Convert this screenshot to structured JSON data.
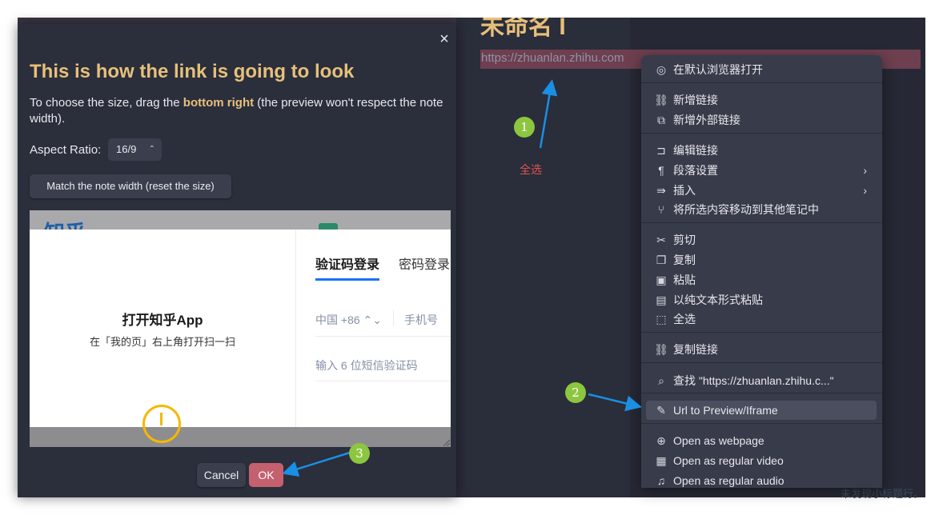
{
  "editor": {
    "note_title": "未命名 I",
    "link_text": "https://zhuanlan.zhihu.com",
    "status_text": "未发现小标题行。"
  },
  "annotations": {
    "step1": "1",
    "step2": "2",
    "step3": "3",
    "label1": "全选",
    "color_circle": "#8cc63f",
    "color_arrow": "#1a8fe3",
    "color_label": "#e05252"
  },
  "context_menu": {
    "items": [
      {
        "icon": "safari-compass-icon",
        "glyph": "◎",
        "label": "在默认浏览器打开"
      },
      {
        "icon": "link-icon",
        "glyph": "⛓",
        "label": "新增链接"
      },
      {
        "icon": "external-link-icon",
        "glyph": "⧉",
        "label": "新增外部链接"
      },
      {
        "icon": "edit-link-icon",
        "glyph": "⊐",
        "label": "编辑链接"
      },
      {
        "icon": "paragraph-icon",
        "glyph": "¶",
        "label": "段落设置",
        "submenu": true
      },
      {
        "icon": "insert-icon",
        "glyph": "⇛",
        "label": "插入",
        "submenu": true
      },
      {
        "icon": "move-branch-icon",
        "glyph": "⑂",
        "label": "将所选内容移动到其他笔记中"
      },
      {
        "icon": "scissors-icon",
        "glyph": "✂",
        "label": "剪切"
      },
      {
        "icon": "copy-icon",
        "glyph": "❐",
        "label": "复制"
      },
      {
        "icon": "clipboard-icon",
        "glyph": "▣",
        "label": "粘贴"
      },
      {
        "icon": "clipboard-text-icon",
        "glyph": "▤",
        "label": "以纯文本形式粘贴"
      },
      {
        "icon": "select-all-icon",
        "glyph": "⬚",
        "label": "全选"
      },
      {
        "icon": "link-icon",
        "glyph": "⛓",
        "label": "复制链接"
      },
      {
        "icon": "search-icon",
        "glyph": "⌕",
        "label": "查找 \"https://zhuanlan.zhihu.c...\""
      },
      {
        "icon": "edit-icon",
        "glyph": "✎",
        "label": "Url to Preview/Iframe",
        "highlighted": true
      },
      {
        "icon": "globe-icon",
        "glyph": "⊕",
        "label": "Open as webpage"
      },
      {
        "icon": "film-icon",
        "glyph": "▦",
        "label": "Open as regular video"
      },
      {
        "icon": "headphones-icon",
        "glyph": "♫",
        "label": "Open as regular audio"
      }
    ]
  },
  "dialog": {
    "close_glyph": "×",
    "title": "This is how the link is going to look",
    "desc_before": "To choose the size, drag the ",
    "desc_bold": "bottom right",
    "desc_after": " (the preview won't respect the note width).",
    "aspect_label": "Aspect Ratio:",
    "aspect_value": "16/9",
    "match_button": "Match the note width (reset the size)",
    "cancel_button": "Cancel",
    "ok_button": "OK",
    "accent_color": "#e6c07b",
    "ok_color": "#c5606f"
  },
  "preview": {
    "bg_logo": "知乎",
    "qr_title": "打开知乎App",
    "qr_sub": "在「我的页」右上角打开扫一扫",
    "tab_sms": "验证码登录",
    "tab_pwd": "密码登录",
    "country_code": "中国 +86 ⌃⌄",
    "phone_placeholder": "手机号",
    "code_placeholder": "输入 6 位短信验证码",
    "tab_color": "#1772f6"
  }
}
